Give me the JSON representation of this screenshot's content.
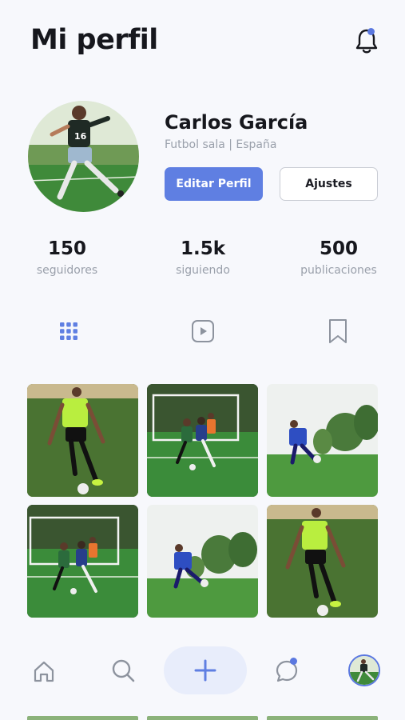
{
  "header": {
    "title": "Mi perfil",
    "icons": [
      "bell-icon"
    ],
    "notification_dot_color": "#5b78e0"
  },
  "profile": {
    "name": "Carlos García",
    "subtitle": "Futbol sala |  España",
    "edit_label": "Editar Perfil",
    "settings_label": "Ajustes",
    "accent_color": "#5f7fe2"
  },
  "stats": [
    {
      "value": "150",
      "label": "seguidores"
    },
    {
      "value": "1.5k",
      "label": "siguiendo"
    },
    {
      "value": "500",
      "label": "publicaciones"
    }
  ],
  "tabs": [
    {
      "icon": "grid-icon",
      "active": true
    },
    {
      "icon": "video-icon",
      "active": false
    },
    {
      "icon": "bookmark-icon",
      "active": false
    }
  ],
  "photos": [
    {
      "subject": "player-neon-kit"
    },
    {
      "subject": "match-goal"
    },
    {
      "subject": "player-blue-kit"
    },
    {
      "subject": "match-goal"
    },
    {
      "subject": "player-blue-kit"
    },
    {
      "subject": "player-neon-kit"
    }
  ],
  "bottom_nav": {
    "items": [
      "home-icon",
      "search-icon",
      "plus-icon",
      "chat-icon",
      "avatar"
    ]
  }
}
